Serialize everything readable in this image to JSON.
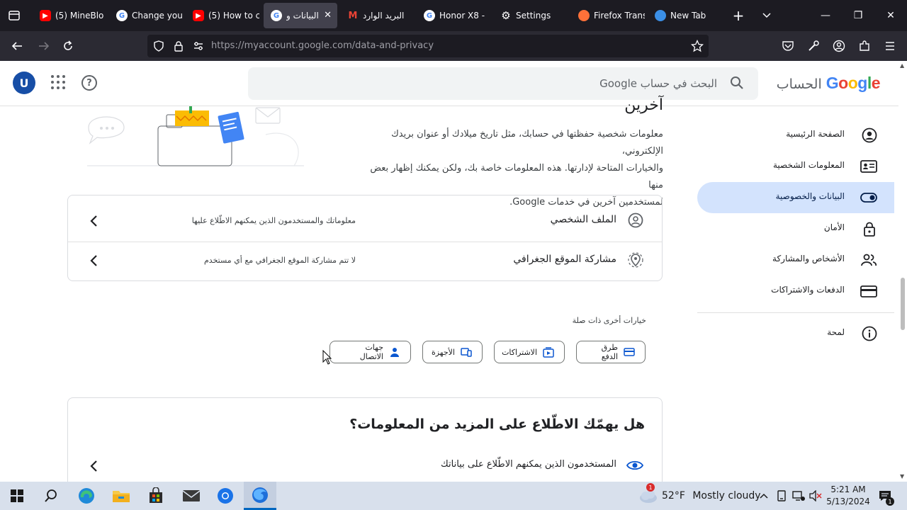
{
  "browser": {
    "tabs": [
      {
        "title": "(5) MineBlo",
        "icon": "youtube-icon"
      },
      {
        "title": "Change you",
        "icon": "google-icon"
      },
      {
        "title": "(5) How to c",
        "icon": "youtube-icon"
      },
      {
        "title": "البيانات و",
        "icon": "google-icon",
        "active": true
      },
      {
        "title": "البريد الوارد",
        "icon": "gmail-icon"
      },
      {
        "title": "Honor X8 - ",
        "icon": "google-icon"
      },
      {
        "title": "Settings",
        "icon": "gear-icon"
      },
      {
        "title": "Firefox Trans",
        "icon": "firefox-icon"
      },
      {
        "title": "New Tab",
        "icon": "edge-icon"
      }
    ],
    "url_host": "https://myaccount.google.com",
    "url_path": "/data-and-privacy"
  },
  "header": {
    "avatar_letter": "U",
    "search_placeholder": "البحث في حساب Google",
    "logo_google": "Google",
    "logo_account": "الحساب"
  },
  "sidebar": {
    "items": [
      {
        "label": "الصفحة الرئيسية",
        "icon": "account-circle-icon"
      },
      {
        "label": "المعلومات الشخصية",
        "icon": "id-card-icon"
      },
      {
        "label": "البيانات والخصوصية",
        "icon": "toggle-icon",
        "active": true
      },
      {
        "label": "الأمان",
        "icon": "lock-icon"
      },
      {
        "label": "الأشخاص والمشاركة",
        "icon": "people-icon"
      },
      {
        "label": "الدفعات والاشتراكات",
        "icon": "credit-card-icon"
      },
      {
        "label": "لمحة",
        "icon": "info-icon"
      }
    ]
  },
  "main": {
    "intro_title": "آخرين",
    "intro_lines": [
      "معلومات شخصية حفظتها في حسابك، مثل تاريخ ميلادك أو عنوان بريدك الإلكتروني،",
      "والخيارات المتاحة لإدارتها. هذه المعلومات خاصة بك، ولكن يمكنك إظهار بعض منها",
      "لمستخدمين آخرين في خدمات Google."
    ],
    "rows": [
      {
        "title": "الملف الشخصي",
        "desc": "معلوماتك والمستخدمون الذين يمكنهم الاطّلاع عليها",
        "icon": "profile-icon"
      },
      {
        "title": "مشاركة الموقع الجغرافي",
        "desc": "لا تتم مشاركة الموقع الجغرافي مع أي مستخدم",
        "icon": "location-share-icon"
      }
    ],
    "other_options_label": "خيارات أخرى ذات صلة",
    "chips": [
      {
        "label": "طرق الدفع",
        "icon": "credit-card-icon"
      },
      {
        "label": "الاشتراكات",
        "icon": "subscriptions-icon"
      },
      {
        "label": "الأجهزة",
        "icon": "devices-icon"
      },
      {
        "label": "جهات الاتصال",
        "icon": "contact-icon"
      }
    ],
    "more_card_title": "هل يهمّك الاطّلاع على المزيد من المعلومات؟",
    "more_card_row": "المستخدمون الذين يمكنهم الاطّلاع على بياناتك"
  },
  "taskbar": {
    "weather_temp": "52°F",
    "weather_text": "Mostly cloudy",
    "weather_badge": "1",
    "time": "5:21 AM",
    "date": "5/13/2024",
    "notif_count": "1"
  }
}
